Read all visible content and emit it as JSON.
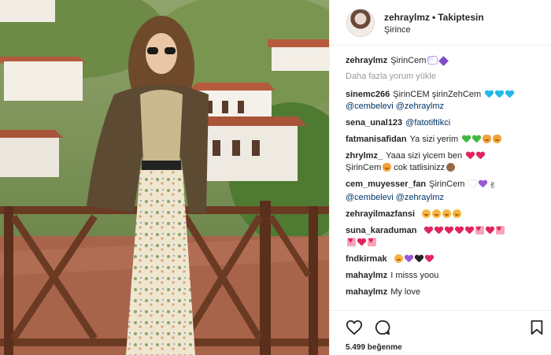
{
  "header": {
    "username": "zehraylmz",
    "separator": "•",
    "follow_label": "Takiptesin",
    "location": "Şirince"
  },
  "load_more_label": "Daha fazla yorum yükle",
  "caption": {
    "user": "zehraylmz",
    "text": "ŞirinCem"
  },
  "comments": [
    {
      "user": "sinemc266",
      "text": "ŞirinCEM şirinZehCem",
      "mentions": "@cembelevi @zehraylmz"
    },
    {
      "user": "sena_unal123",
      "text": "@fatotiftikci"
    },
    {
      "user": "fatmanisafidan",
      "text": "Ya sizi yerim"
    },
    {
      "user": "zhrylmz_",
      "text": "Yaaa sizi yicem ben",
      "text2": "ŞirinCem",
      "text3": "cok tatlisinizz"
    },
    {
      "user": "cem_muyesser_fan",
      "text": "ŞirinCem",
      "mentions": "@cembelevi @zehraylmz"
    },
    {
      "user": "zehrayilmazfansi",
      "text": ""
    },
    {
      "user": "suna_karaduman",
      "text": ""
    },
    {
      "user": "fndkirmak",
      "text": ""
    },
    {
      "user": "mahaylmz",
      "text": "I misss yoou"
    },
    {
      "user": "mahaylmz",
      "text": "My love"
    }
  ],
  "likes_label": "5.499 beğenme",
  "icons": [
    "heart-outline-icon",
    "comment-bubble-icon",
    "bookmark-icon",
    "gem-emoji",
    "unicorn-emoji",
    "heart-emoji",
    "cat-emoji",
    "face-emoji",
    "monkey-emoji",
    "hand-emoji"
  ],
  "colors": {
    "username": "#262626",
    "muted": "#999999",
    "mention": "#003569",
    "divider": "#efefef"
  }
}
